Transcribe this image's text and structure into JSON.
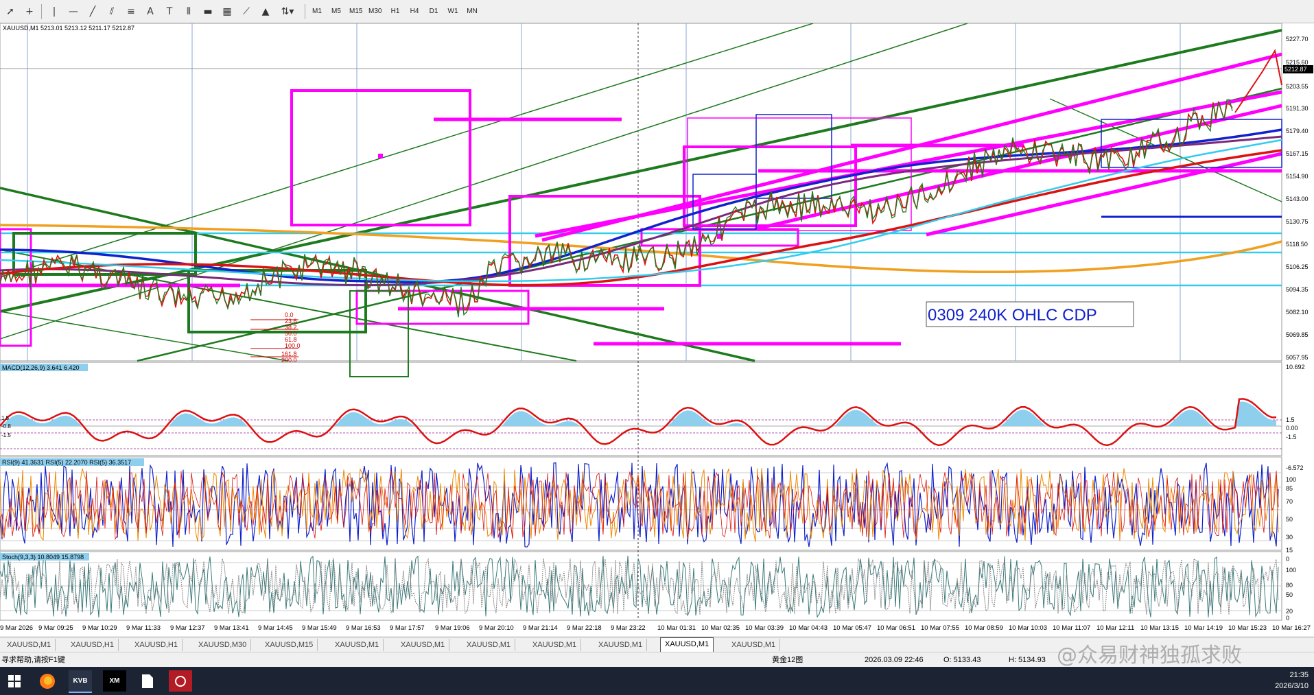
{
  "toolbar": {
    "tools": [
      "cursor-icon",
      "crosshair-icon",
      "vertical-line-icon",
      "horizontal-line-icon",
      "trendline-icon",
      "channel-icon",
      "fibonacci-icon",
      "text-icon",
      "label-icon",
      "gann-icon",
      "rectangle-icon",
      "grid-icon",
      "pitchfork-icon",
      "triangle-icon",
      "arrows-icon"
    ],
    "timeframes": [
      "M1",
      "M5",
      "M15",
      "M30",
      "H1",
      "H4",
      "D1",
      "W1",
      "MN"
    ]
  },
  "chart": {
    "header": "XAUUSD,M1  5213.01 5213.12 5211.17 5212.87",
    "price_labels": [
      "5227.70",
      "5215.60",
      "5212.87",
      "5203.55",
      "5191.30",
      "5179.40",
      "5167.15",
      "5154.90",
      "5143.00",
      "5130.75",
      "5118.50",
      "5106.25",
      "5094.35",
      "5082.10",
      "5069.85",
      "5057.95"
    ],
    "current_price": "5212.87",
    "annotation": "0309  240K  OHLC  CDP",
    "fib_labels": [
      "0.0",
      "23.6",
      "38.2",
      "50.0",
      "61.8",
      "100.0",
      "161.8",
      "200.0"
    ],
    "colors": {
      "magenta": "#ff00ff",
      "darkgreen": "#1e7a1e",
      "cyan": "#33ccee",
      "orange": "#f0a020",
      "red": "#dd1111",
      "blue": "#1122cc",
      "purple": "#7a2a7a"
    }
  },
  "macd": {
    "label": "MACD(12,26,9) 3.641 6.420",
    "scale": [
      "10.692",
      "1.5",
      "0.00",
      "-1.5",
      "-6.572"
    ],
    "left_levels": [
      "1.5",
      "0.00",
      "-0.8",
      "-1.5"
    ]
  },
  "rsi": {
    "label": "RSI(9) 41.3631  RSI(5) 22.2070  RSI(5) 36.3517",
    "scale": [
      "100",
      "85",
      "70",
      "50",
      "30",
      "15",
      "0"
    ]
  },
  "stoch": {
    "label": "Stoch(9,3,3) 10.8049 15.8798",
    "scale": [
      "100",
      "80",
      "50",
      "20",
      "0"
    ]
  },
  "time_labels": [
    "9 Mar 2026",
    "9 Mar 09:25",
    "9 Mar 10:29",
    "9 Mar 11:33",
    "9 Mar 12:37",
    "9 Mar 13:41",
    "9 Mar 14:45",
    "9 Mar 15:49",
    "9 Mar 16:53",
    "9 Mar 17:57",
    "9 Mar 19:06",
    "9 Mar 20:10",
    "9 Mar 21:14",
    "9 Mar 22:18",
    "9 Mar 23:22",
    "10 Mar 01:31",
    "10 Mar 02:35",
    "10 Mar 03:39",
    "10 Mar 04:43",
    "10 Mar 05:47",
    "10 Mar 06:51",
    "10 Mar 07:55",
    "10 Mar 08:59",
    "10 Mar 10:03",
    "10 Mar 11:07",
    "10 Mar 12:11",
    "10 Mar 13:15",
    "10 Mar 14:19",
    "10 Mar 15:23",
    "10 Mar 16:27"
  ],
  "tabs": [
    "XAUUSD,M1",
    "XAUUSD,H1",
    "XAUUSD,H1",
    "XAUUSD,M30",
    "XAUUSD,M15",
    "XAUUSD,M1",
    "XAUUSD,M1",
    "XAUUSD,M1",
    "XAUUSD,M1",
    "XAUUSD,M1",
    "XAUUSD,M1",
    "XAUUSD,M1"
  ],
  "active_tab_index": 10,
  "status": {
    "help": "寻求帮助,请按F1键",
    "profile": "黄金12图",
    "datetime": "2026.03.09 22:46",
    "open": "O: 5133.43",
    "high": "H: 5134.93"
  },
  "taskbar": {
    "apps": [
      "windows-icon",
      "firefox-icon",
      "kvb-app-icon",
      "xm-app-icon",
      "file-icon",
      "broker-app-icon"
    ],
    "kvb_label": "KVB",
    "xm_label": "XM",
    "time": "21:35",
    "date": "2026/3/10"
  },
  "watermark": "@众易财神独孤求败"
}
